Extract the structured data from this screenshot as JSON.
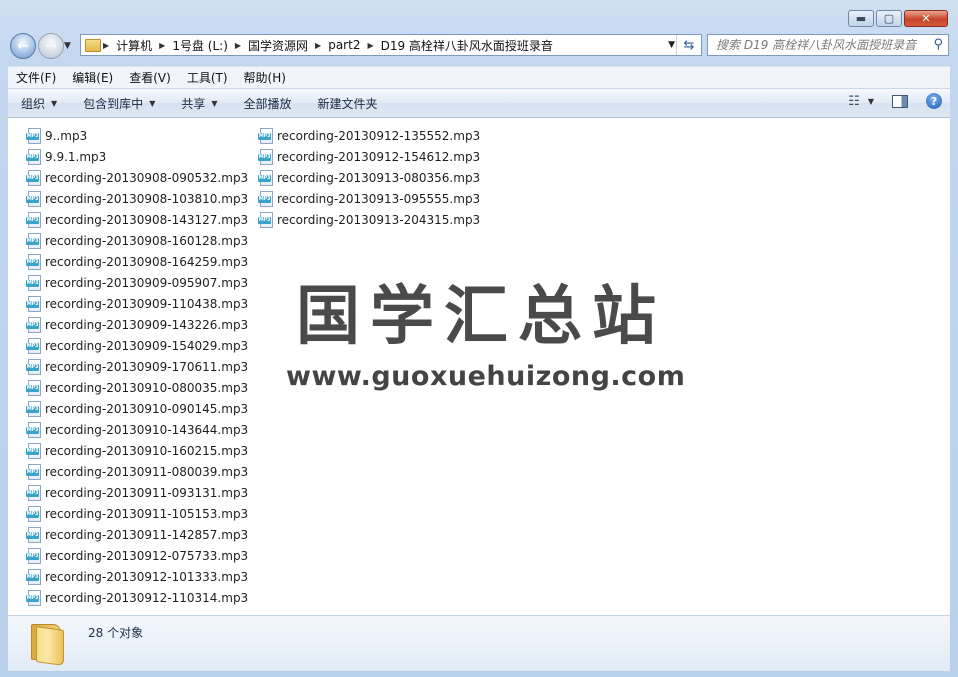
{
  "window": {
    "controls": {
      "minimize": "▬",
      "maximize": "▢",
      "close": "✕"
    }
  },
  "nav": {
    "back_icon": "back-arrow-icon",
    "forward_icon": "forward-arrow-icon",
    "breadcrumbs": [
      "计算机",
      "1号盘 (L:)",
      "国学资源网",
      "part2",
      "D19 高栓祥八卦风水面授班录音"
    ],
    "search_placeholder": "搜索 D19 高栓祥八卦风水面授班录音"
  },
  "menu": [
    "文件(F)",
    "编辑(E)",
    "查看(V)",
    "工具(T)",
    "帮助(H)"
  ],
  "toolbar": {
    "organize": "组织",
    "include_library": "包含到库中",
    "share": "共享",
    "play_all": "全部播放",
    "new_folder": "新建文件夹"
  },
  "files": {
    "col1": [
      "9..mp3",
      "9.9.1.mp3",
      "recording-20130908-090532.mp3",
      "recording-20130908-103810.mp3",
      "recording-20130908-143127.mp3",
      "recording-20130908-160128.mp3",
      "recording-20130908-164259.mp3",
      "recording-20130909-095907.mp3",
      "recording-20130909-110438.mp3",
      "recording-20130909-143226.mp3",
      "recording-20130909-154029.mp3",
      "recording-20130909-170611.mp3",
      "recording-20130910-080035.mp3",
      "recording-20130910-090145.mp3",
      "recording-20130910-143644.mp3",
      "recording-20130910-160215.mp3",
      "recording-20130911-080039.mp3",
      "recording-20130911-093131.mp3",
      "recording-20130911-105153.mp3",
      "recording-20130911-142857.mp3",
      "recording-20130912-075733.mp3",
      "recording-20130912-101333.mp3",
      "recording-20130912-110314.mp3"
    ],
    "col2": [
      "recording-20130912-135552.mp3",
      "recording-20130912-154612.mp3",
      "recording-20130913-080356.mp3",
      "recording-20130913-095555.mp3",
      "recording-20130913-204315.mp3"
    ],
    "icon_tag": "MP3"
  },
  "watermark": {
    "chinese": "国学汇总站",
    "url": "www.guoxuehuizong.com"
  },
  "status": {
    "count_text": "28 个对象"
  }
}
